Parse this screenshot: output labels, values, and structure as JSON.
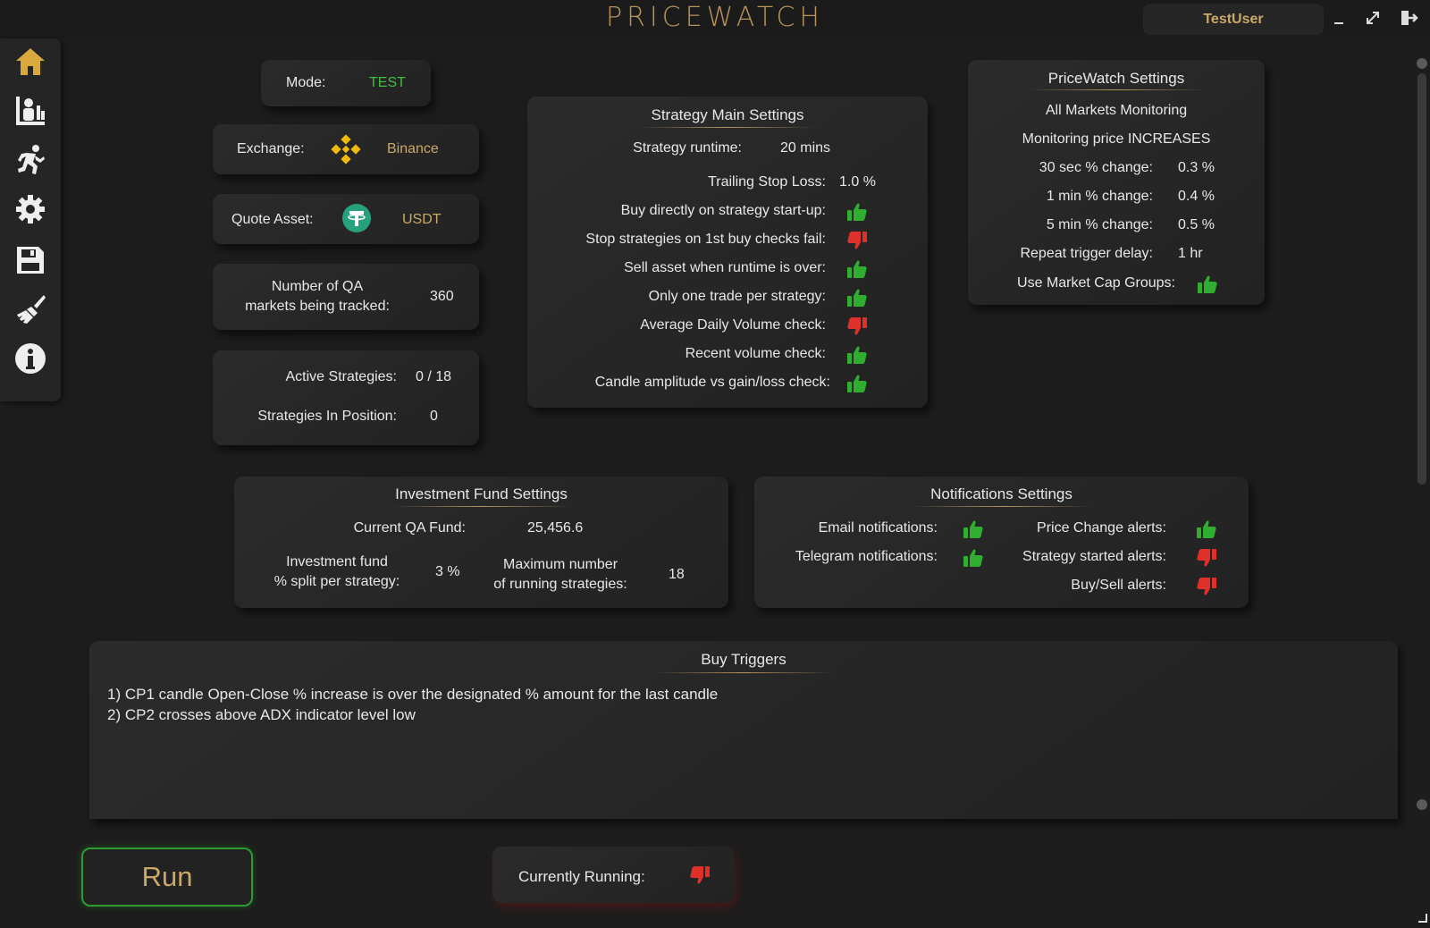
{
  "window": {
    "title": "PRICEWATCH",
    "user": "TestUser",
    "controls": [
      "minimize-icon",
      "maximize-icon",
      "logout-icon"
    ]
  },
  "sidebar": {
    "items": [
      "home-icon",
      "dashboard-icon",
      "strategies-icon",
      "settings-icon",
      "save-icon",
      "clean-icon",
      "info-icon"
    ]
  },
  "colors": {
    "accent": "#b8935a",
    "positive": "#2fae2f",
    "negative": "#e0302a",
    "mode": "#3fbf3f"
  },
  "mode": {
    "label": "Mode:",
    "value": "TEST"
  },
  "exchange": {
    "label": "Exchange:",
    "value": "Binance"
  },
  "quote_asset": {
    "label": "Quote Asset:",
    "value": "USDT"
  },
  "markets": {
    "label_line1": "Number of QA",
    "label_line2": "markets being tracked:",
    "value": "360"
  },
  "strategies": {
    "active_label": "Active Strategies:",
    "active_value": "0 / 18",
    "in_position_label": "Strategies In Position:",
    "in_position_value": "0"
  },
  "strategy_main": {
    "title": "Strategy Main Settings",
    "runtime_label": "Strategy runtime:",
    "runtime_value": "20 mins",
    "trailing_label": "Trailing Stop Loss:",
    "trailing_value": "1.0 %",
    "checks": [
      {
        "label": "Buy directly on strategy start-up:",
        "on": true
      },
      {
        "label": "Stop strategies on 1st buy checks fail:",
        "on": false
      },
      {
        "label": "Sell asset when runtime is over:",
        "on": true
      },
      {
        "label": "Only one trade per strategy:",
        "on": true
      },
      {
        "label": "Average Daily Volume check:",
        "on": false
      },
      {
        "label": "Recent volume check:",
        "on": true
      },
      {
        "label": "Candle amplitude vs gain/loss check:",
        "on": true
      }
    ]
  },
  "pricewatch": {
    "title": "PriceWatch Settings",
    "line1": "All Markets Monitoring",
    "line2": "Monitoring price INCREASES",
    "rows": [
      {
        "label": "30 sec % change:",
        "value": "0.3 %"
      },
      {
        "label": "1 min % change:",
        "value": "0.4 %"
      },
      {
        "label": "5 min % change:",
        "value": "0.5 %"
      },
      {
        "label": "Repeat trigger delay:",
        "value": "1 hr"
      }
    ],
    "market_cap_label": "Use Market Cap Groups:",
    "market_cap_on": true
  },
  "investment": {
    "title": "Investment Fund Settings",
    "fund_label": "Current QA Fund:",
    "fund_value": "25,456.6",
    "split_line1": "Investment fund",
    "split_line2": "% split per strategy:",
    "split_value": "3 %",
    "max_line1": "Maximum number",
    "max_line2": "of running strategies:",
    "max_value": "18"
  },
  "notifications": {
    "title": "Notifications Settings",
    "email_label": "Email notifications:",
    "email_on": true,
    "telegram_label": "Telegram notifications:",
    "telegram_on": true,
    "price_label": "Price Change alerts:",
    "price_on": true,
    "started_label": "Strategy started alerts:",
    "started_on": false,
    "buysell_label": "Buy/Sell alerts:",
    "buysell_on": false
  },
  "buy_triggers": {
    "title": "Buy Triggers",
    "lines": [
      "1) CP1 candle Open-Close % increase is over the designated % amount for the last candle",
      "2) CP2 crosses above ADX indicator level low"
    ]
  },
  "run_button": "Run",
  "running": {
    "label": "Currently Running:",
    "on": false
  }
}
